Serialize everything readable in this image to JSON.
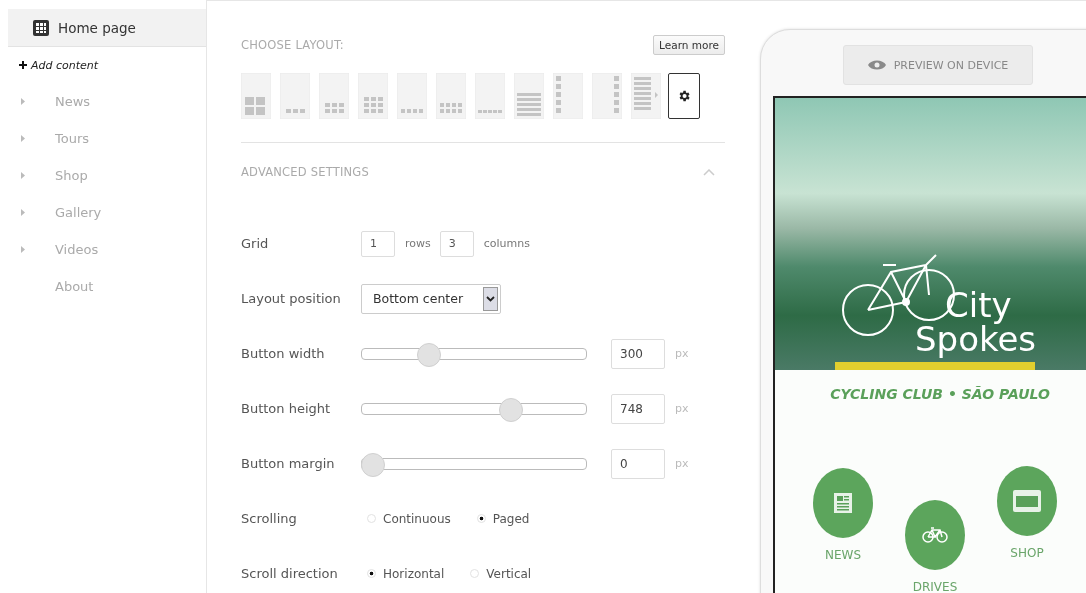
{
  "sidebar": {
    "items": [
      {
        "label": "Home page",
        "kind": "page",
        "selected": true,
        "expandable": false
      },
      {
        "label": "Add content",
        "kind": "add",
        "selected": false,
        "expandable": false
      },
      {
        "label": "News",
        "kind": "item",
        "selected": false,
        "expandable": true
      },
      {
        "label": "Tours",
        "kind": "item",
        "selected": false,
        "expandable": true
      },
      {
        "label": "Shop",
        "kind": "item",
        "selected": false,
        "expandable": true
      },
      {
        "label": "Gallery",
        "kind": "item",
        "selected": false,
        "expandable": true
      },
      {
        "label": "Videos",
        "kind": "item",
        "selected": false,
        "expandable": true
      },
      {
        "label": "About",
        "kind": "item",
        "selected": false,
        "expandable": false
      }
    ]
  },
  "layout": {
    "title": "CHOOSE LAYOUT:",
    "learn_more": "Learn more",
    "tiles": [
      {
        "kind": "grid4"
      },
      {
        "kind": "bottom3"
      },
      {
        "kind": "bottom3x2"
      },
      {
        "kind": "grid3x3"
      },
      {
        "kind": "bottom4"
      },
      {
        "kind": "bottom4x2"
      },
      {
        "kind": "bottom5"
      },
      {
        "kind": "list"
      },
      {
        "kind": "left-column"
      },
      {
        "kind": "right-column"
      },
      {
        "kind": "list-more"
      }
    ]
  },
  "advanced": {
    "title": "ADVANCED SETTINGS",
    "expanded": true,
    "grid": {
      "label": "Grid",
      "rows": "1",
      "rows_unit": "rows",
      "columns": "3",
      "columns_unit": "columns"
    },
    "layout_position": {
      "label": "Layout position",
      "value": "Bottom center"
    },
    "sliders": [
      {
        "label": "Button width",
        "level": 0.28,
        "value": "300",
        "unit": "px"
      },
      {
        "label": "Button height",
        "level": 0.69,
        "value": "748",
        "unit": "px"
      },
      {
        "label": "Button margin",
        "level": 0,
        "value": "0",
        "unit": "px"
      }
    ],
    "radio_groups": [
      {
        "label": "Scrolling",
        "options": [
          {
            "label": "Continuous",
            "selected": false
          },
          {
            "label": "Paged",
            "selected": true
          }
        ]
      },
      {
        "label": "Scroll direction",
        "options": [
          {
            "label": "Horizontal",
            "selected": true
          },
          {
            "label": "Vertical",
            "selected": false
          }
        ]
      }
    ]
  },
  "preview": {
    "button": "PREVIEW ON DEVICE",
    "logo": [
      "City",
      "Spokes"
    ],
    "tagline": "CYCLING CLUB • SÃO PAULO",
    "buttons": [
      {
        "label": "NEWS",
        "kind": "news"
      },
      {
        "label": "DRIVES",
        "kind": "bike"
      },
      {
        "label": "SHOP",
        "kind": "shop"
      }
    ]
  }
}
